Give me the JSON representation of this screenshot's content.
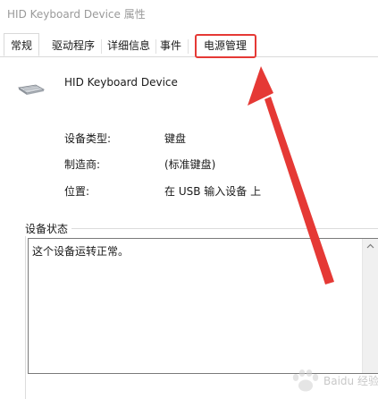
{
  "window": {
    "title": "HID Keyboard Device 属性"
  },
  "tabs": [
    {
      "label": "常规",
      "active": true
    },
    {
      "label": "驱动程序",
      "active": false
    },
    {
      "label": "详细信息",
      "active": false
    },
    {
      "label": "事件",
      "active": false
    },
    {
      "label": "电源管理",
      "active": false
    }
  ],
  "device": {
    "name": "HID Keyboard Device",
    "icon": "keyboard-icon"
  },
  "properties": [
    {
      "label": "设备类型:",
      "value": "键盘"
    },
    {
      "label": "制造商:",
      "value": "(标准键盘)"
    },
    {
      "label": "位置:",
      "value": "在 USB 输入设备 上"
    }
  ],
  "status": {
    "legend": "设备状态",
    "text": "这个设备运转正常。"
  },
  "annotation": {
    "highlight_color": "#e53935",
    "arrow_color": "#e53935"
  },
  "watermark": {
    "brand_text": "Baidu 经验",
    "icon": "baidu-paw-icon"
  }
}
